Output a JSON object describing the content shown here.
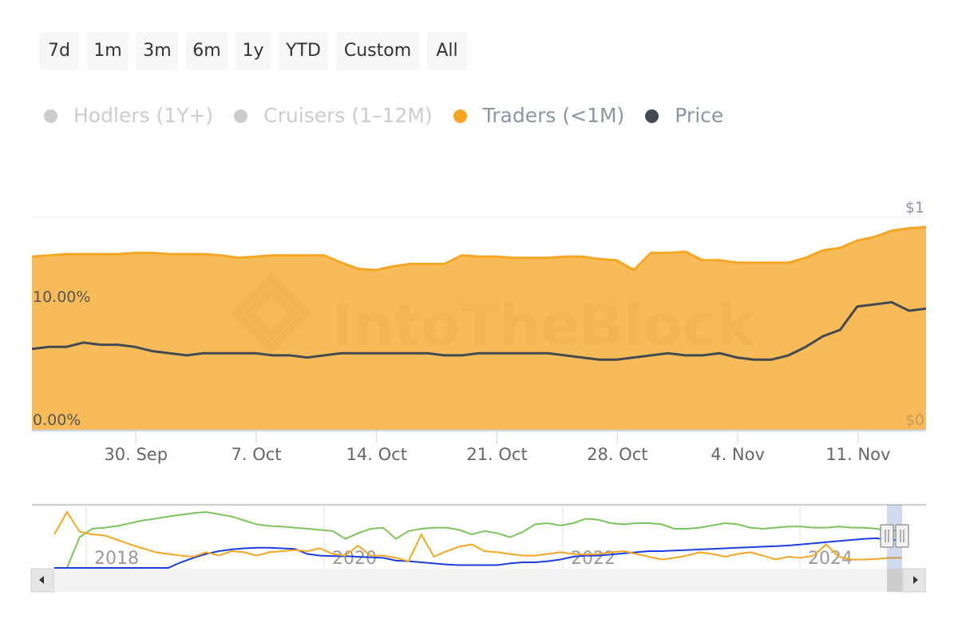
{
  "range_selector": {
    "buttons": [
      {
        "label": "7d"
      },
      {
        "label": "1m"
      },
      {
        "label": "3m"
      },
      {
        "label": "6m"
      },
      {
        "label": "1y"
      },
      {
        "label": "YTD"
      },
      {
        "label": "Custom"
      },
      {
        "label": "All"
      }
    ]
  },
  "legend": {
    "items": [
      {
        "label": "Hodlers (1Y+)",
        "color": "#7cc55b",
        "visible": false
      },
      {
        "label": "Cruisers (1–12M)",
        "color": "#1a3fe0",
        "visible": false
      },
      {
        "label": "Traders (<1M)",
        "color": "#f5a623",
        "visible": true
      },
      {
        "label": "Price",
        "color": "#434a52",
        "visible": true
      }
    ]
  },
  "watermark": "IntoTheBlock",
  "chart_data": {
    "type": "area",
    "title": "",
    "xlabel": "",
    "ylabel_left": "",
    "ylabel_right": "",
    "x_start": "24 Sep",
    "x_end": "14 Nov",
    "x_tick_labels": [
      "30. Sep",
      "7. Oct",
      "14. Oct",
      "21. Oct",
      "28. Oct",
      "4. Nov",
      "11. Nov"
    ],
    "y_left_ticks": [
      "0.00%",
      "10.00%"
    ],
    "y_left_range": [
      0,
      17.3
    ],
    "y_right_ticks": [
      "$0",
      "$1"
    ],
    "y_right_range": [
      0,
      1
    ],
    "grid": true,
    "legend_position": "top-left",
    "series": [
      {
        "name": "Traders (<1M)",
        "axis": "left",
        "type": "area",
        "color": "#f5a623",
        "unit": "%",
        "values": [
          14.1,
          14.2,
          14.3,
          14.3,
          14.3,
          14.3,
          14.4,
          14.4,
          14.3,
          14.3,
          14.3,
          14.2,
          14.0,
          14.1,
          14.2,
          14.2,
          14.2,
          14.2,
          13.6,
          13.1,
          13.0,
          13.3,
          13.5,
          13.5,
          13.5,
          14.2,
          14.1,
          14.1,
          14.0,
          14.0,
          14.0,
          14.1,
          14.1,
          13.9,
          13.8,
          13.0,
          14.4,
          14.4,
          14.5,
          13.8,
          13.8,
          13.6,
          13.6,
          13.6,
          13.6,
          14.0,
          14.6,
          14.8,
          15.4,
          15.7,
          16.2,
          16.4,
          16.5
        ]
      },
      {
        "name": "Price",
        "axis": "right",
        "type": "line",
        "color": "#434a52",
        "unit": "$",
        "values": [
          0.38,
          0.39,
          0.39,
          0.41,
          0.4,
          0.4,
          0.39,
          0.37,
          0.36,
          0.35,
          0.36,
          0.36,
          0.36,
          0.36,
          0.35,
          0.35,
          0.34,
          0.35,
          0.36,
          0.36,
          0.36,
          0.36,
          0.36,
          0.36,
          0.35,
          0.35,
          0.36,
          0.36,
          0.36,
          0.36,
          0.36,
          0.35,
          0.34,
          0.33,
          0.33,
          0.34,
          0.35,
          0.36,
          0.35,
          0.35,
          0.36,
          0.34,
          0.33,
          0.33,
          0.35,
          0.39,
          0.44,
          0.47,
          0.58,
          0.59,
          0.6,
          0.56,
          0.57
        ]
      }
    ],
    "navigator": {
      "x_tick_labels": [
        "2018",
        "2020",
        "2022",
        "2024"
      ],
      "series": [
        {
          "name": "Hodlers (1Y+)",
          "color": "#7cc55b",
          "values": [
            0,
            0,
            0.55,
            0.7,
            0.72,
            0.75,
            0.8,
            0.85,
            0.88,
            0.92,
            0.95,
            0.98,
            1.0,
            0.96,
            0.92,
            0.85,
            0.78,
            0.75,
            0.74,
            0.72,
            0.7,
            0.68,
            0.66,
            0.52,
            0.62,
            0.7,
            0.72,
            0.52,
            0.66,
            0.7,
            0.72,
            0.72,
            0.68,
            0.6,
            0.66,
            0.62,
            0.55,
            0.64,
            0.78,
            0.8,
            0.76,
            0.8,
            0.88,
            0.86,
            0.8,
            0.78,
            0.8,
            0.8,
            0.78,
            0.7,
            0.7,
            0.72,
            0.76,
            0.8,
            0.78,
            0.72,
            0.7,
            0.72,
            0.74,
            0.74,
            0.72,
            0.72,
            0.74,
            0.72,
            0.72,
            0.7,
            0.66,
            0.68
          ]
        },
        {
          "name": "Cruisers (1–12M)",
          "color": "#1a3fe0",
          "values": [
            0,
            0,
            0,
            0,
            0,
            0,
            0,
            0,
            0,
            0,
            0.1,
            0.18,
            0.25,
            0.3,
            0.33,
            0.35,
            0.36,
            0.36,
            0.35,
            0.34,
            0.25,
            0.22,
            0.21,
            0.21,
            0.2,
            0.19,
            0.18,
            0.13,
            0.12,
            0.1,
            0.08,
            0.06,
            0.05,
            0.05,
            0.05,
            0.05,
            0.08,
            0.1,
            0.1,
            0.12,
            0.15,
            0.2,
            0.22,
            0.22,
            0.24,
            0.26,
            0.28,
            0.3,
            0.3,
            0.31,
            0.32,
            0.33,
            0.34,
            0.35,
            0.36,
            0.37,
            0.38,
            0.39,
            0.4,
            0.42,
            0.44,
            0.46,
            0.48,
            0.5,
            0.52,
            0.53,
            0.5,
            0.5
          ]
        },
        {
          "name": "Traders (<1M)",
          "color": "#f5a623",
          "values": [
            0.6,
            1.0,
            0.65,
            0.6,
            0.58,
            0.5,
            0.42,
            0.35,
            0.28,
            0.25,
            0.22,
            0.2,
            0.28,
            0.22,
            0.3,
            0.28,
            0.22,
            0.28,
            0.3,
            0.32,
            0.3,
            0.35,
            0.25,
            0.22,
            0.4,
            0.22,
            0.22,
            0.18,
            0.12,
            0.6,
            0.2,
            0.3,
            0.38,
            0.42,
            0.3,
            0.28,
            0.25,
            0.22,
            0.22,
            0.25,
            0.28,
            0.25,
            0.24,
            0.25,
            0.28,
            0.3,
            0.25,
            0.2,
            0.15,
            0.18,
            0.22,
            0.28,
            0.25,
            0.2,
            0.25,
            0.28,
            0.22,
            0.15,
            0.2,
            0.18,
            0.22,
            0.42,
            0.2,
            0.15,
            0.15,
            0.16,
            0.18,
            0.18
          ]
        }
      ],
      "selected_range": "last ~2 months"
    }
  }
}
